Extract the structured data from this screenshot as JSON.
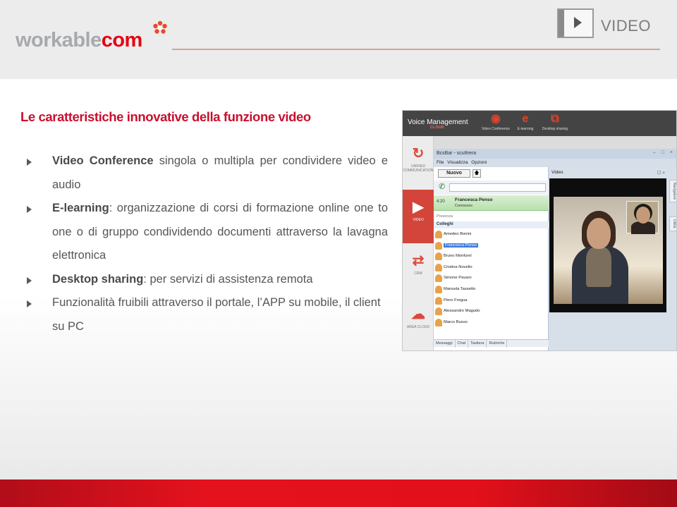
{
  "brand": {
    "logo_gray": "workable",
    "logo_red": "com",
    "accent": "#e30613",
    "gray": "#a7a9ac",
    "flower_icon": "flower-icon"
  },
  "header": {
    "video_label": "VIDEO",
    "play_icon": "play-icon"
  },
  "content": {
    "title": "Le caratteristiche innovative della funzione video",
    "title_color": "#c8102e",
    "bullets": [
      {
        "strong": "Video Conference",
        "rest": " singola o multipla per condividere video e audio"
      },
      {
        "strong": "E-learning",
        "rest": ": organizzazione di corsi di formazione online one to one o di gruppo condividendo documenti attraverso la lavagna elettronica"
      },
      {
        "strong": "Desktop sharing",
        "rest": ": per servizi di assistenza remota"
      },
      {
        "strong": "",
        "rest": "Funzionalità fruibili attraverso il portale, l’APP su mobile, il client su PC"
      }
    ]
  },
  "screenshot": {
    "top_bar": {
      "title": "Voice Management",
      "cloud": "CLOUD",
      "items": [
        {
          "label": "Video Conference",
          "icon": "webcam-icon",
          "glyph": "◉"
        },
        {
          "label": "E-learning",
          "icon": "e-learning-icon",
          "glyph": "e"
        },
        {
          "label": "Desktop sharing",
          "icon": "desktop-sharing-icon",
          "glyph": "⧉"
        }
      ]
    },
    "sidebar": [
      {
        "label": "UNIFIED COMMUNICATION",
        "icon": "sync-icon",
        "glyph": "↻",
        "active": false
      },
      {
        "label": "VIDEO",
        "icon": "video-icon",
        "glyph": "▶",
        "active": true
      },
      {
        "label": "CRM",
        "icon": "crm-icon",
        "glyph": "⇄",
        "active": false
      },
      {
        "label": "AREA CLOUD",
        "icon": "cloud-icon",
        "glyph": "☁",
        "active": false
      }
    ],
    "app": {
      "window_title": "BcsBar - scuttrera",
      "window_buttons": "– □ ×",
      "menu": [
        "File",
        "Visualizza",
        "Opzioni"
      ],
      "new_button": "Nuovo",
      "up_button": "🡅",
      "call": {
        "time": "4:20",
        "name": "Francesca Penso",
        "state": "Connesso"
      },
      "presence_label": "Presenza",
      "group": "Colleghi",
      "contacts": [
        {
          "name": "Amedeo Bonini",
          "selected": false
        },
        {
          "name": "Francesca Penso",
          "selected": true
        },
        {
          "name": "Bruno Monfurel",
          "selected": false
        },
        {
          "name": "Cristina Novello",
          "selected": false
        },
        {
          "name": "Simone Pavaro",
          "selected": false
        },
        {
          "name": "Manuela Tassetto",
          "selected": false
        },
        {
          "name": "Piero Fregua",
          "selected": false
        },
        {
          "name": "Alessandro Magudo",
          "selected": false
        },
        {
          "name": "Marco Busso",
          "selected": false
        }
      ],
      "tabs": [
        "Messaggi",
        "Chat",
        "Tastiera",
        "Rubriche"
      ],
      "video_title": "Video",
      "video_buttons": "☐ ×",
      "side_tabs": [
        "Navigatore",
        "Utilità"
      ]
    }
  }
}
